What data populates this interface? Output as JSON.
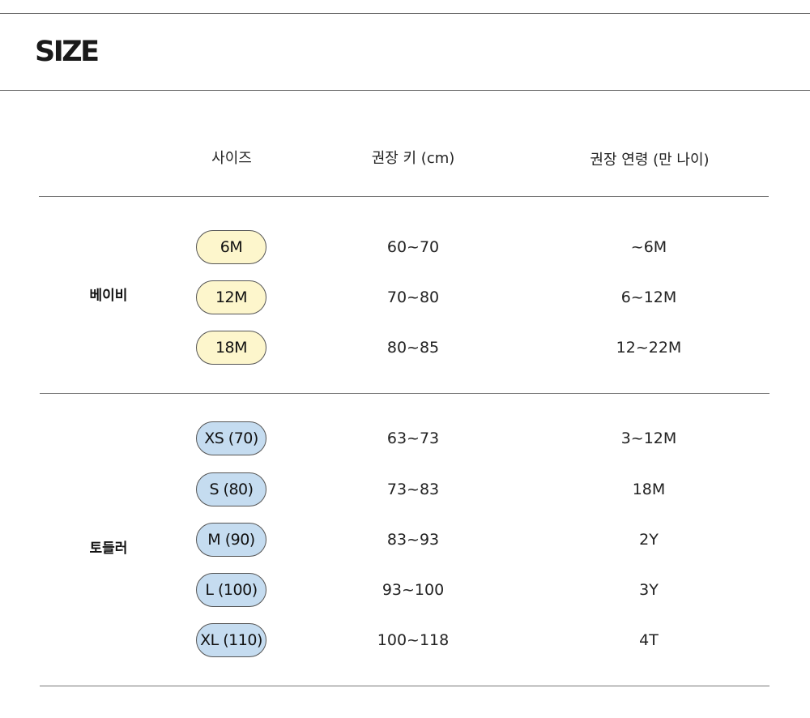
{
  "title": "SIZE",
  "headers": {
    "size": "사이즈",
    "height": "권장 키 (cm)",
    "age": "권장 연령 (만 나이)"
  },
  "groups": [
    {
      "label": "베이비",
      "pill_color": "#fdf6cc",
      "rows": [
        {
          "size": "6M",
          "height": "60~70",
          "age": "~6M"
        },
        {
          "size": "12M",
          "height": "70~80",
          "age": "6~12M"
        },
        {
          "size": "18M",
          "height": "80~85",
          "age": "12~22M"
        }
      ]
    },
    {
      "label": "토들러",
      "pill_color": "#c5dcf0",
      "rows": [
        {
          "size": "XS (70)",
          "height": "63~73",
          "age": "3~12M"
        },
        {
          "size": "S (80)",
          "height": "73~83",
          "age": "18M"
        },
        {
          "size": "M (90)",
          "height": "83~93",
          "age": "2Y"
        },
        {
          "size": "L (100)",
          "height": "93~100",
          "age": "3Y"
        },
        {
          "size": "XL (110)",
          "height": "100~118",
          "age": "4T"
        }
      ]
    }
  ]
}
